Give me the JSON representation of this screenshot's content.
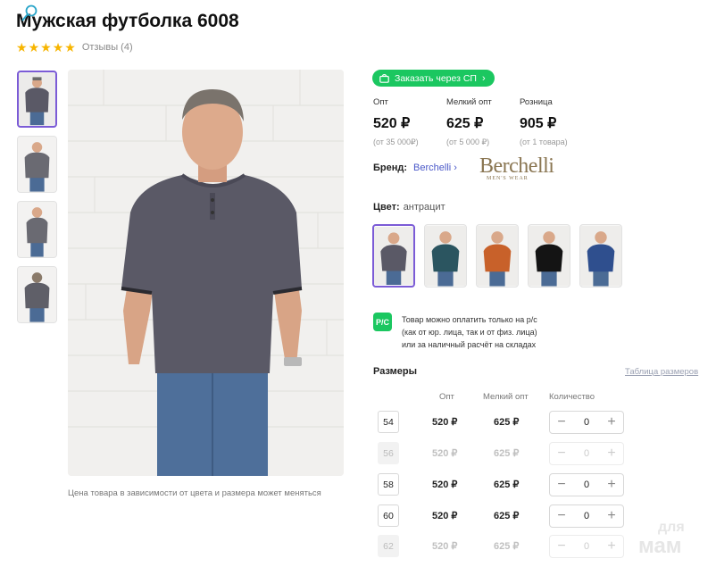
{
  "product": {
    "title": "Мужская футболка 6008",
    "rating_stars": 5,
    "reviews_label": "Отзывы (4)"
  },
  "gallery": {
    "thumbnails": [
      "thumb-front",
      "thumb-front-2",
      "thumb-side",
      "thumb-back"
    ],
    "active_index": 0,
    "note": "Цена товара в зависимости от цвета и размера может меняться"
  },
  "order_button": {
    "label": "Заказать через СП",
    "icon": "cart-icon",
    "color": "#1bc760"
  },
  "prices": [
    {
      "label": "Опт",
      "value": "520 ₽",
      "min": "(от 35 000₽)"
    },
    {
      "label": "Мелкий опт",
      "value": "625 ₽",
      "min": "(от 5 000 ₽)"
    },
    {
      "label": "Розница",
      "value": "905 ₽",
      "min": "(от 1 товара)"
    }
  ],
  "brand": {
    "label": "Бренд:",
    "name": "Berchelli",
    "logo_text": "Berchelli",
    "logo_subtext": "MEN'S WEAR"
  },
  "color": {
    "label": "Цвет:",
    "value": "антрацит",
    "swatches": [
      {
        "name": "антрацит",
        "hex": "#5a5966"
      },
      {
        "name": "морская волна",
        "hex": "#2b5560"
      },
      {
        "name": "терракот",
        "hex": "#c8612a"
      },
      {
        "name": "черный",
        "hex": "#141414"
      },
      {
        "name": "синий",
        "hex": "#2f4f8e"
      }
    ],
    "active_index": 0
  },
  "payment": {
    "icon_text": "Р/С",
    "lines": [
      "Товар можно оплатить только на р/с",
      "(как от юр. лица, так и от физ. лица)",
      "или за наличный расчёт на складах"
    ]
  },
  "sizes": {
    "title": "Размеры",
    "table_link": "Таблица размеров",
    "headers": {
      "opt": "Опт",
      "small_opt": "Мелкий опт",
      "qty": "Количество"
    },
    "rows": [
      {
        "size": "54",
        "opt": "520 ₽",
        "small_opt": "625 ₽",
        "qty": "0",
        "available": true
      },
      {
        "size": "56",
        "opt": "520 ₽",
        "small_opt": "625 ₽",
        "qty": "0",
        "available": false
      },
      {
        "size": "58",
        "opt": "520 ₽",
        "small_opt": "625 ₽",
        "qty": "0",
        "available": true
      },
      {
        "size": "60",
        "opt": "520 ₽",
        "small_opt": "625 ₽",
        "qty": "0",
        "available": true
      },
      {
        "size": "62",
        "opt": "520 ₽",
        "small_opt": "625 ₽",
        "qty": "0",
        "available": false
      }
    ],
    "minus": "−",
    "plus": "+"
  },
  "watermark": {
    "line1": "для",
    "line2": "мам"
  }
}
